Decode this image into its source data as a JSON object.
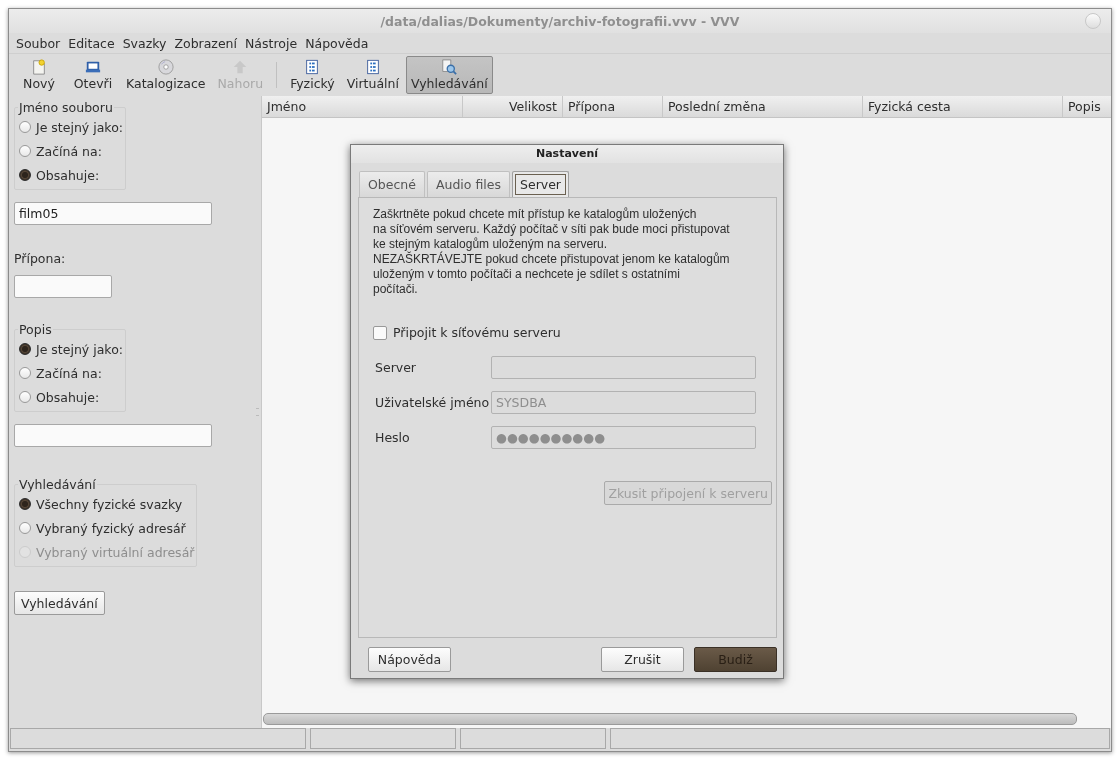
{
  "window": {
    "title": "/data/dalias/Dokumenty/archiv-fotografii.vvv - VVV"
  },
  "menu": [
    "Soubor",
    "Editace",
    "Svazky",
    "Zobrazení",
    "Nástroje",
    "Nápověda"
  ],
  "toolbar": [
    {
      "label": "Nový",
      "kind": "new",
      "disabled": false,
      "selected": false
    },
    {
      "label": "Otevři",
      "kind": "open",
      "disabled": false,
      "selected": false
    },
    {
      "label": "Katalogizace",
      "kind": "disc",
      "disabled": false,
      "selected": false
    },
    {
      "label": "Nahoru",
      "kind": "up",
      "disabled": true,
      "selected": false
    },
    {
      "label": "Fyzický",
      "kind": "list",
      "disabled": false,
      "selected": false
    },
    {
      "label": "Virtuální",
      "kind": "list",
      "disabled": false,
      "selected": false
    },
    {
      "label": "Vyhledávání",
      "kind": "search",
      "disabled": false,
      "selected": true
    }
  ],
  "search_panel": {
    "filename_group": {
      "title": "Jméno souboru",
      "options": [
        {
          "label": "Je stejný jako:",
          "selected": false,
          "disabled": false
        },
        {
          "label": "Začíná na:",
          "selected": false,
          "disabled": false
        },
        {
          "label": "Obsahuje:",
          "selected": true,
          "disabled": false
        }
      ]
    },
    "filename_field": {
      "value": "film05"
    },
    "extension_label": "Přípona:",
    "description_group": {
      "title": "Popis",
      "options": [
        {
          "label": "Je stejný jako:",
          "selected": true,
          "disabled": false
        },
        {
          "label": "Začíná na:",
          "selected": false,
          "disabled": false
        },
        {
          "label": "Obsahuje:",
          "selected": false,
          "disabled": false
        }
      ]
    },
    "scope_group": {
      "title": "Vyhledávání",
      "options": [
        {
          "label": "Všechny fyzické svazky",
          "selected": true,
          "disabled": false
        },
        {
          "label": "Vybraný fyzický adresář",
          "selected": false,
          "disabled": false
        },
        {
          "label": "Vybraný virtuální adresář",
          "selected": false,
          "disabled": true
        }
      ]
    },
    "search_button": "Vyhledávání"
  },
  "table": {
    "columns": [
      "Jméno",
      "Velikost",
      "Přípona",
      "Poslední změna",
      "Fyzická cesta",
      "Popis"
    ]
  },
  "dialog": {
    "title": "Nastavení",
    "tabs": [
      {
        "label": "Obecné",
        "selected": false
      },
      {
        "label": "Audio files",
        "selected": false
      },
      {
        "label": "Server",
        "selected": true
      }
    ],
    "description": "Zaškrtněte pokud chcete mít přístup ke katalogům uložených\nna síťovém serveru. Každý počítač v síti pak bude moci přistupovat\nke stejným katalogům uloženým na serveru.\nNEZAŠKRTÁVEJTE pokud chcete přistupovat jenom ke katalogům\nuloženým v tomto počítači a nechcete je sdílet s ostatními\npočítači.",
    "checkbox": {
      "label": "Připojit k síťovému serveru",
      "checked": false
    },
    "fields": [
      {
        "label": "Server",
        "disabled": true
      },
      {
        "label": "Uživatelské jméno",
        "value": "SYSDBA",
        "disabled": true
      },
      {
        "label": "Heslo",
        "value": "●●●●●●●●●●",
        "disabled": true
      }
    ],
    "test_button": {
      "label": "Zkusit připojení k serveru",
      "disabled": true
    },
    "buttons": [
      {
        "label": "Nápověda",
        "default": false
      },
      {
        "label": "Zrušit",
        "default": false
      },
      {
        "label": "Budiž",
        "default": true
      }
    ]
  }
}
